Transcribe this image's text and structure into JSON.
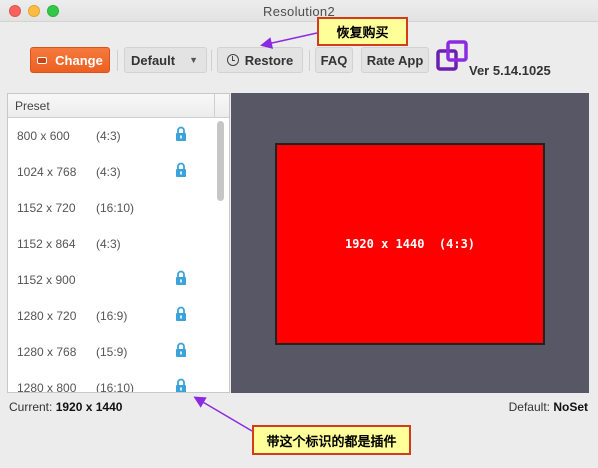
{
  "window": {
    "title": "Resolution2"
  },
  "toolbar": {
    "change_label": "Change",
    "preset_select_value": "Default",
    "restore_label": "Restore",
    "faq_label": "FAQ",
    "rate_label": "Rate App",
    "version": "Ver 5.14.1025"
  },
  "preset_list": {
    "header": "Preset",
    "items": [
      {
        "resolution": "800 x 600",
        "ratio": "(4:3)",
        "locked": true
      },
      {
        "resolution": "1024 x 768",
        "ratio": "(4:3)",
        "locked": true
      },
      {
        "resolution": "1152 x 720",
        "ratio": "(16:10)",
        "locked": false
      },
      {
        "resolution": "1152 x 864",
        "ratio": "(4:3)",
        "locked": false
      },
      {
        "resolution": "1152 x 900",
        "ratio": "",
        "locked": true
      },
      {
        "resolution": "1280 x 720",
        "ratio": "(16:9)",
        "locked": true
      },
      {
        "resolution": "1280 x 768",
        "ratio": "(15:9)",
        "locked": true
      },
      {
        "resolution": "1280 x 800",
        "ratio": "(16:10)",
        "locked": true
      }
    ]
  },
  "preview": {
    "label": "1920 x 1440  (4:3)"
  },
  "status": {
    "current_label": "Current:",
    "current_value": "1920 x 1440",
    "default_label": "Default:",
    "default_value": "NoSet"
  },
  "annotations": {
    "restore_note": "恢复购买",
    "lock_note": "带这个标识的都是插件"
  },
  "colors": {
    "accent": "#ee5f22",
    "lock": "#3ba3d9",
    "preview_bg": "#575766",
    "screen": "#ff0000",
    "callout_bg": "#ffff99",
    "callout_border": "#d43a1c",
    "arrow": "#8a2be2"
  },
  "icons": {
    "change": "display-icon",
    "restore": "clock-icon",
    "lock": "lock-icon",
    "logo": "overlapping-squares-logo"
  }
}
